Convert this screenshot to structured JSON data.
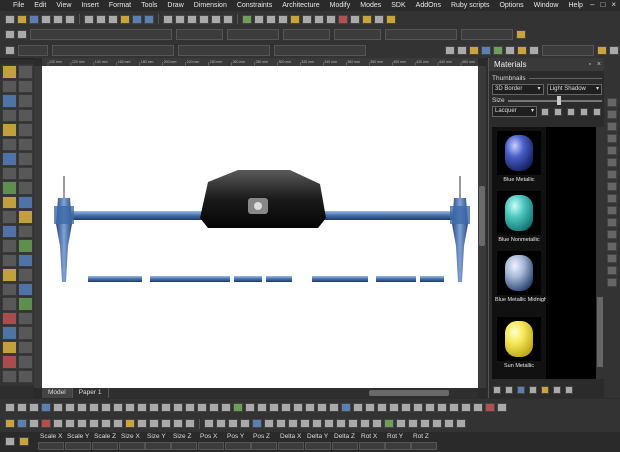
{
  "menu": [
    "File",
    "Edit",
    "View",
    "Insert",
    "Format",
    "Tools",
    "Draw",
    "Dimension",
    "Constraints",
    "Architecture",
    "Modify",
    "Modes",
    "SDK",
    "AddOns",
    "Ruby scripts",
    "Options",
    "Window",
    "Help"
  ],
  "window_controls": [
    "–",
    "□",
    "×"
  ],
  "viewport": {
    "tabs": [
      "Model",
      "Paper 1"
    ],
    "ruler_labels": [
      "100 mm",
      "120 mm",
      "140 mm",
      "160 mm",
      "180 mm",
      "200 mm",
      "220 mm",
      "240 mm",
      "260 mm",
      "280 mm",
      "300 mm",
      "320 mm",
      "340 mm",
      "360 mm",
      "380 mm",
      "400 mm",
      "420 mm",
      "440 mm",
      "460 mm"
    ]
  },
  "materials_panel": {
    "title": "Materials",
    "mode_label": "Thumbnails",
    "render_style": "3D Border",
    "shadow": "Light Shadow",
    "size_label": "Size",
    "category": "Lacquer",
    "items": [
      {
        "label": "Blue Metallic",
        "color_top": "#4a5fc8",
        "color_bottom": "#101a55"
      },
      {
        "label": "Blue Nonmetallic",
        "color_top": "#4fc7c0",
        "color_bottom": "#0e6f6a"
      },
      {
        "label": "Blue Metallic Midnight",
        "color_top": "#a8b8d8",
        "color_bottom": "#223866"
      },
      {
        "label": "Sun Metallic",
        "color_top": "#f5e85a",
        "color_bottom": "#b8a20c"
      }
    ]
  },
  "status": {
    "labels": [
      "Scale X",
      "Scale Y",
      "Scale Z",
      "Size X",
      "Size Y",
      "Size Z",
      "Pos X",
      "Pos Y",
      "Pos Z",
      "Delta X",
      "Delta Y",
      "Delta Z",
      "Rot X",
      "Rot Y",
      "Rot Z"
    ]
  },
  "colors": {
    "arm": "#4a74b0",
    "body": "#1c1c1c",
    "ui_bg": "#2d2d2d"
  }
}
